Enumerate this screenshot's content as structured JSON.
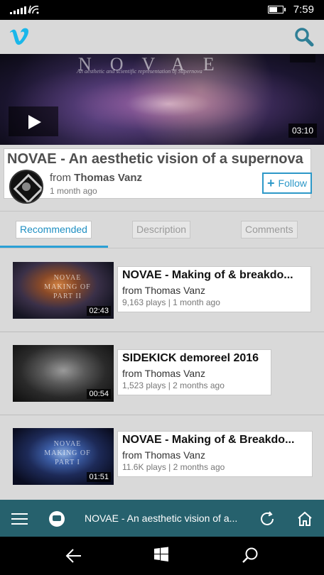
{
  "status_bar": {
    "time": "7:59"
  },
  "header": {
    "logo_icon": "vimeo-logo-icon",
    "search_icon": "search-icon",
    "brand_color": "#1ab7ea"
  },
  "hero": {
    "brand_text": "NOVAE",
    "tagline": "An aesthetic and scientific representation of Supernova",
    "duration": "03:10"
  },
  "video": {
    "title": "NOVAE - An aesthetic vision of a supernova",
    "from_label": "from",
    "author": "Thomas Vanz",
    "posted": "1 month ago",
    "follow_label": "Follow"
  },
  "tabs": [
    {
      "label": "Recommended",
      "active": true
    },
    {
      "label": "Description",
      "active": false
    },
    {
      "label": "Comments",
      "active": false
    }
  ],
  "recommended": [
    {
      "title": "NOVAE - Making of & breakdo...",
      "from": "from Thomas Vanz",
      "meta": "9,163 plays | 1 month ago",
      "duration": "02:43",
      "thumb_text": "NOVAE MAKING OF PART II"
    },
    {
      "title": "SIDEKICK demoreel 2016",
      "from": "from Thomas Vanz",
      "meta": "1,523 plays | 2 months ago",
      "duration": "00:54",
      "thumb_text": ""
    },
    {
      "title": "NOVAE - Making of & Breakdo...",
      "from": "from Thomas Vanz",
      "meta": "11.6K plays | 2 months ago",
      "duration": "01:51",
      "thumb_text": "NOVAE MAKING OF PART I"
    }
  ],
  "bottom_bar": {
    "now_playing": "NOVAE - An aesthetic vision of a...",
    "accent": "#26616d"
  }
}
